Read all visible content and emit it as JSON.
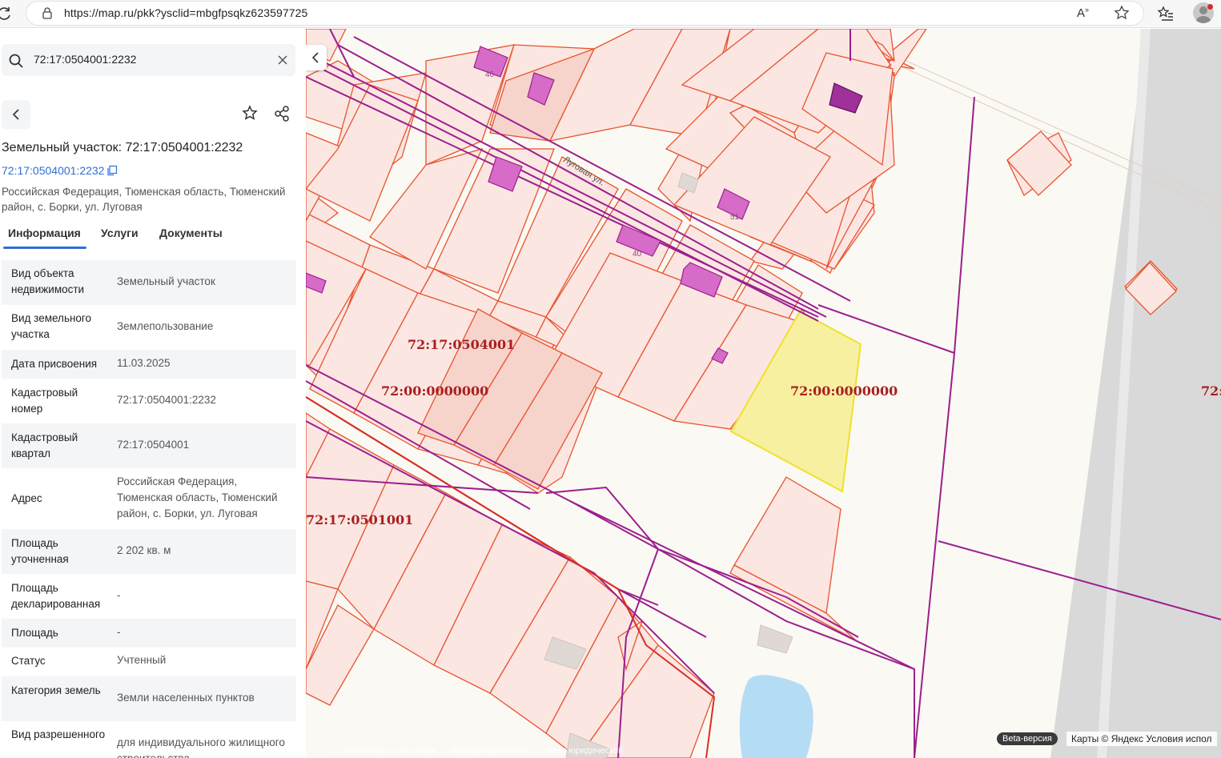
{
  "browser": {
    "url": "https://map.ru/pkk?ysclid=mbgfpsqkz623597725"
  },
  "search": {
    "value": "72:17:0504001:2232"
  },
  "card": {
    "title": "Земельный участок: 72:17:0504001:2232",
    "cad_link": "72:17:0504001:2232",
    "address": "Российская Федерация, Тюменская область, Тюменский район, с. Борки, ул. Луговая",
    "tabs": [
      "Информация",
      "Услуги",
      "Документы"
    ],
    "active_tab": "Информация"
  },
  "info_rows": [
    {
      "key": "Вид объекта недвижимости",
      "value": "Земельный участок"
    },
    {
      "key": "Вид земельного участка",
      "value": "Землепользование"
    },
    {
      "key": "Дата присвоения",
      "value": "11.03.2025"
    },
    {
      "key": "Кадастровый номер",
      "value": "72:17:0504001:2232"
    },
    {
      "key": "Кадастровый квартал",
      "value": "72:17:0504001"
    },
    {
      "key": "Адрес",
      "value": "Российская Федерация, Тюменская область, Тюменский район, с. Борки, ул. Луговая"
    },
    {
      "key": "Площадь уточненная",
      "value": "2 202 кв. м"
    },
    {
      "key": "Площадь декларированная",
      "value": "-"
    },
    {
      "key": "Площадь",
      "value": "-"
    },
    {
      "key": "Статус",
      "value": "Учтенный"
    },
    {
      "key": "Категория земель",
      "value": "Земли населенных пунктов"
    },
    {
      "key": "Вид разрешенного",
      "value": "для индивидуального жилищного строительства"
    }
  ],
  "map": {
    "quarter_labels": [
      "72:17:0504001",
      "72:00:0000000",
      "72:00:0000000",
      "72:17:0501001",
      "72:"
    ],
    "street": "Луговая ул.",
    "house_numbers": [
      "46",
      "40",
      "51"
    ],
    "beta": "Beta-версия",
    "copyright": "Карты © Яндекс   Условия испол",
    "disclaimer": "… источников и не связан …                 информация носит …                                имеет юридической",
    "colors": {
      "parcel_fill": "#fbe6e2",
      "parcel_stroke": "#e8532e",
      "boundary": "#9b1f8e",
      "selected_fill": "#f7f0a0",
      "selected_stroke": "#f0e030",
      "building": "#d76bc8",
      "water": "#b5dcf5",
      "road": "#d9d9d9"
    }
  }
}
